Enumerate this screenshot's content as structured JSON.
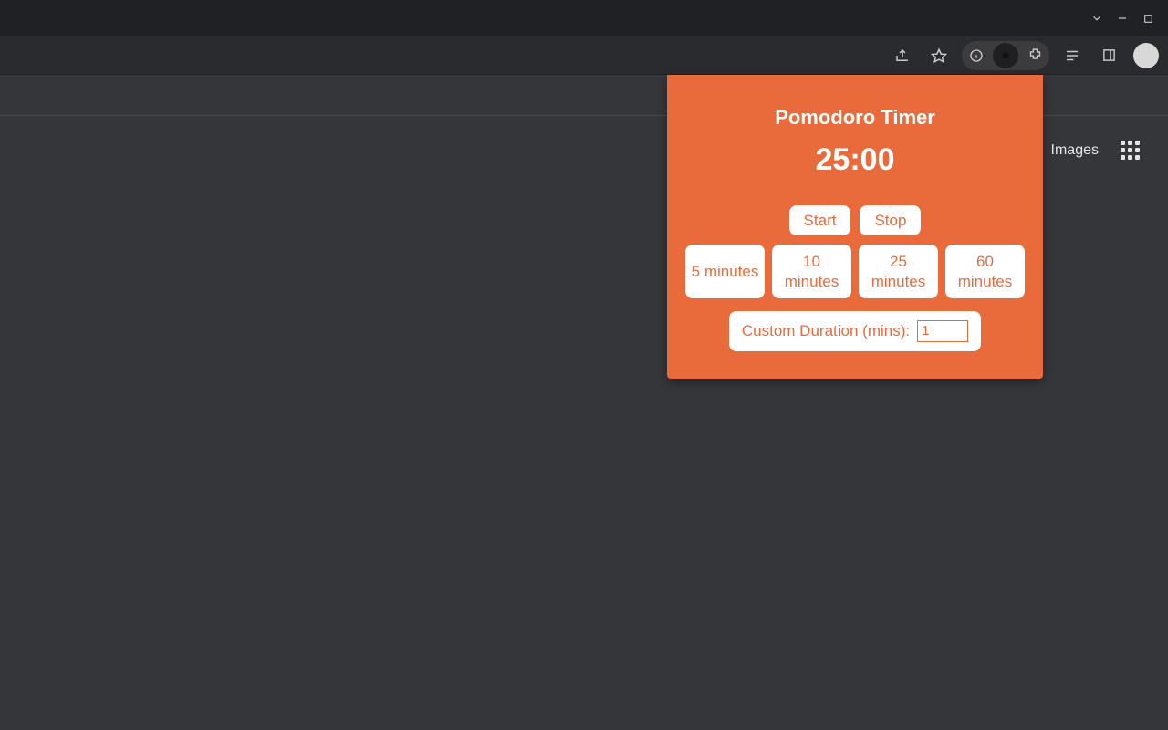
{
  "page": {
    "links": {
      "images": "Images"
    }
  },
  "popup": {
    "title": "Pomodoro Timer",
    "time": "25:00",
    "buttons": {
      "start": "Start",
      "stop": "Stop"
    },
    "presets": [
      {
        "label": "5 minutes"
      },
      {
        "label": "10 minutes"
      },
      {
        "label": "25 minutes"
      },
      {
        "label": "60 minutes"
      }
    ],
    "custom": {
      "label": "Custom Duration (mins):",
      "value": "1"
    }
  }
}
